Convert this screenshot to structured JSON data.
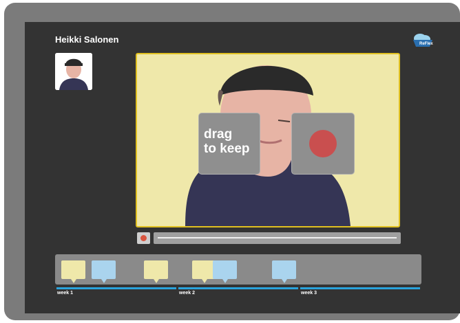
{
  "app": {
    "logo_text": "ReFlex",
    "logo_icon": "cloud-logo-icon"
  },
  "header": {
    "user_name": "Heikki Salonen"
  },
  "video": {
    "drag_card_label": "drag to keep",
    "record_icon": "record-icon"
  },
  "player": {
    "record_button_icon": "record-icon",
    "progress": 0.0
  },
  "timeline": {
    "notes": [
      {
        "color": "yellow"
      },
      {
        "color": "blue"
      },
      {
        "color": "yellow"
      },
      {
        "color": "yellow"
      },
      {
        "color": "blue"
      },
      {
        "color": "blue"
      }
    ],
    "weeks": [
      {
        "label": "week 1"
      },
      {
        "label": "week 2"
      },
      {
        "label": "week 3"
      }
    ]
  },
  "colors": {
    "accent_blue": "#2aa3dc",
    "record_red": "#c94f4f",
    "note_yellow": "#efe8aa",
    "note_blue": "#aad4ee",
    "frame_yellow": "#e0c020"
  }
}
